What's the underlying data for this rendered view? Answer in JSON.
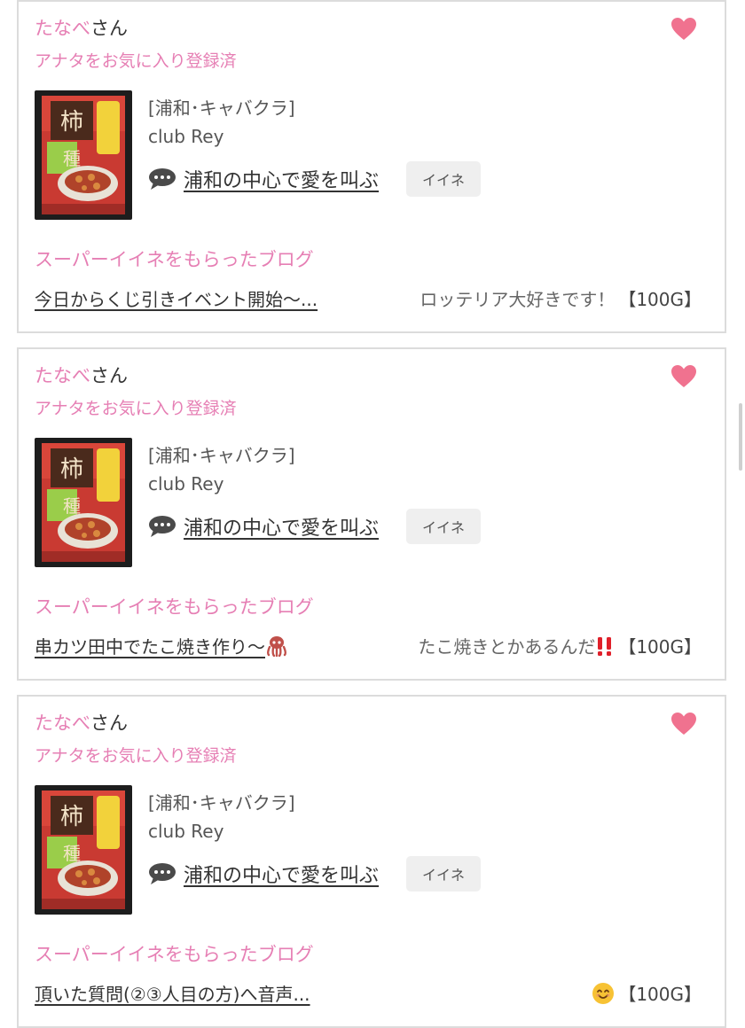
{
  "cards": [
    {
      "user_name": "たなべ",
      "honorific": "さん",
      "favorite_status": "アナタをお気に入り登録済",
      "shop_category": "[浦和･キャバクラ]",
      "shop_name": "club Rey",
      "catchphrase": "浦和の中心で愛を叫ぶ",
      "iine_label": "イイネ",
      "super_label": "スーパーイイネをもらったブログ",
      "blog_title": "今日からくじ引きイベント開始〜...",
      "blog_comment": "ロッテリア大好きです！",
      "points": "【100G】",
      "title_emoji": "",
      "comment_emoji": ""
    },
    {
      "user_name": "たなべ",
      "honorific": "さん",
      "favorite_status": "アナタをお気に入り登録済",
      "shop_category": "[浦和･キャバクラ]",
      "shop_name": "club Rey",
      "catchphrase": "浦和の中心で愛を叫ぶ",
      "iine_label": "イイネ",
      "super_label": "スーパーイイネをもらったブログ",
      "blog_title": "串カツ田中でたこ焼き作り〜",
      "blog_comment": "たこ焼きとかあるんだ",
      "points": "【100G】",
      "title_emoji": "octopus-icon",
      "comment_emoji": "double-exclamation-icon"
    },
    {
      "user_name": "たなべ",
      "honorific": "さん",
      "favorite_status": "アナタをお気に入り登録済",
      "shop_category": "[浦和･キャバクラ]",
      "shop_name": "club Rey",
      "catchphrase": "浦和の中心で愛を叫ぶ",
      "iine_label": "イイネ",
      "super_label": "スーパーイイネをもらったブログ",
      "blog_title": "頂いた質問(②③人目の方)へ音声...",
      "blog_comment": "",
      "points": "【100G】",
      "title_emoji": "",
      "comment_emoji": "smiling-face-icon"
    }
  ],
  "colors": {
    "accent_pink": "#e67fb4",
    "heart_pink": "#f0728f",
    "text_dark": "#333333",
    "card_border": "#dcdcdc",
    "button_bg": "#efefef"
  }
}
